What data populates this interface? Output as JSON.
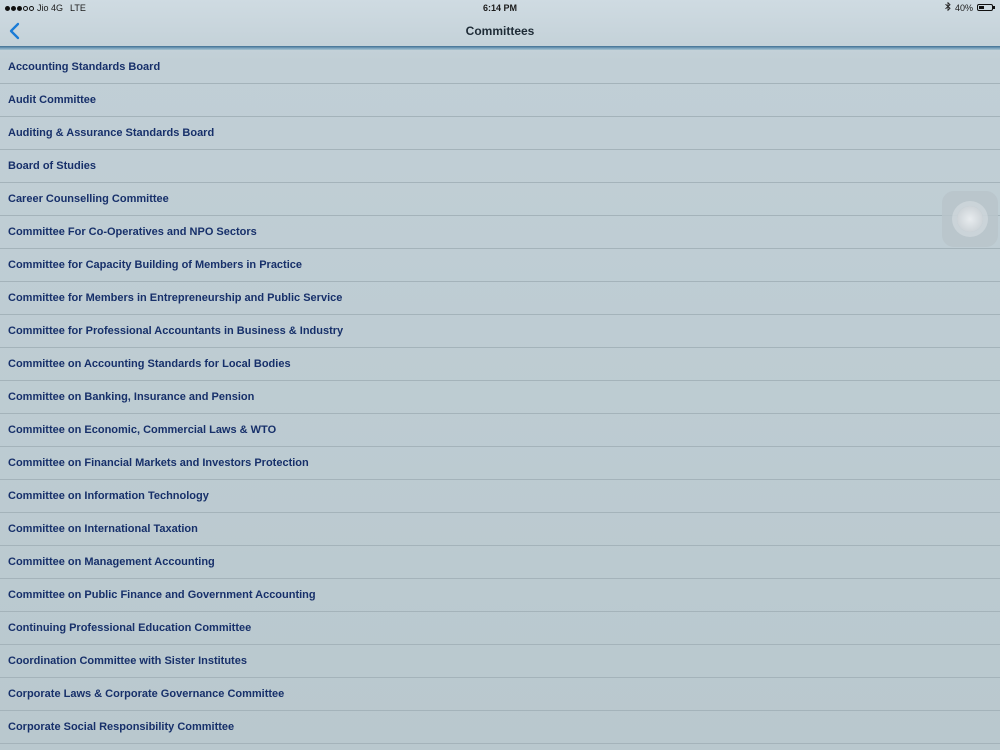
{
  "status_bar": {
    "carrier": "Jio 4G",
    "network": "LTE",
    "time": "6:14 PM",
    "battery_text": "40%",
    "battery_level": 0.4,
    "signal_bars": 3,
    "signal_total": 5
  },
  "nav": {
    "title": "Committees",
    "back_icon": "chevron-left-icon",
    "accent_color": "#1a7bd6"
  },
  "committees": [
    "Accounting Standards Board",
    "Audit Committee",
    "Auditing & Assurance Standards Board",
    "Board of Studies",
    "Career Counselling Committee",
    "Committee For Co-Operatives and NPO Sectors",
    "Committee for Capacity Building of Members in Practice",
    "Committee for Members in Entrepreneurship and Public Service",
    "Committee for Professional Accountants in Business & Industry",
    "Committee on Accounting Standards for Local Bodies",
    "Committee on Banking, Insurance and Pension",
    "Committee on Economic, Commercial Laws & WTO",
    "Committee on Financial Markets and Investors Protection",
    "Committee on Information Technology",
    "Committee on International Taxation",
    "Committee on Management Accounting",
    "Committee on Public Finance and Government Accounting",
    "Continuing Professional Education Committee",
    "Coordination Committee with Sister Institutes",
    "Corporate Laws & Corporate Governance Committee",
    "Corporate Social Responsibility Committee"
  ]
}
